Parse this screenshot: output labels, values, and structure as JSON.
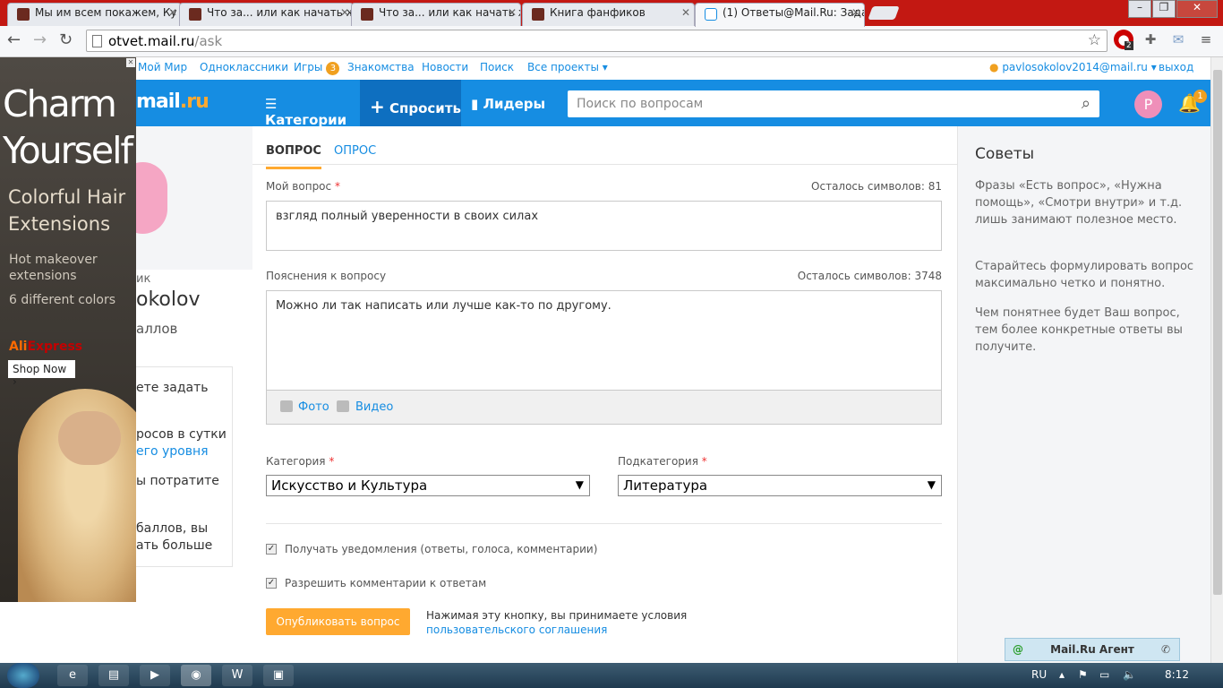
{
  "browser": {
    "tabs": [
      {
        "title": "Мы им всем покажем, Ку"
      },
      {
        "title": "Что за... или как начать ж"
      },
      {
        "title": "Что за... или как начать ж"
      },
      {
        "title": "Книга фанфиков"
      },
      {
        "title": "(1) Ответы@Mail.Ru: Зада"
      }
    ],
    "url_host": "otvet.mail.ru",
    "url_path": "/ask",
    "ext_badge": "2"
  },
  "portal": {
    "links": [
      "Мой Мир",
      "Одноклассники",
      "Игры",
      "Знакомства",
      "Новости",
      "Поиск",
      "Все проекты"
    ],
    "games_badge": "3",
    "user_email": "pavlosokolov2014@mail.ru",
    "logout": "выход"
  },
  "header": {
    "logo_main": "mail",
    "logo_suffix": ".ru",
    "nav": [
      "Категории",
      "Спросить",
      "Лидеры"
    ],
    "search_placeholder": "Поиск по вопросам",
    "avatar_letter": "P",
    "notif_count": "1"
  },
  "ad": {
    "headline1": "Charm",
    "headline2": "Yourself",
    "sub1": "Colorful Hair",
    "sub2": "Extensions",
    "small1": "Hot makeover",
    "small2": "extensions",
    "small3": "6 different colors",
    "brand1": "Ali",
    "brand2": "Express",
    "cta": "Shop Now ›"
  },
  "sidebar": {
    "role": "ик",
    "name": "okolov",
    "points": "аллов",
    "info1": "ете задать",
    "info2": "росов в сутки",
    "info3": "его уровня",
    "info4": "ы потратите",
    "info5": "баллов, вы",
    "info6": "ать больше"
  },
  "form": {
    "tab_question": "ВОПРОС",
    "tab_poll": "ОПРОС",
    "q_label": "Мой вопрос",
    "q_remaining": "Осталось символов: 81",
    "q_value": "взгляд полный уверенности в своих силах",
    "d_label": "Пояснения к вопросу",
    "d_remaining": "Осталось символов: 3748",
    "d_value": "Можно ли так написать или лучше как-то по другому.",
    "photo": "Фото",
    "video": "Видео",
    "cat_label": "Категория",
    "cat_value": "Искусство и Культура",
    "subcat_label": "Подкатегория",
    "subcat_value": "Литература",
    "notify_label": "Получать уведомления (ответы, голоса, комментарии)",
    "comments_label": "Разрешить комментарии к ответам",
    "publish": "Опубликовать вопрос",
    "terms1": "Нажимая эту кнопку, вы принимаете условия",
    "terms2": "пользовательского соглашения",
    "required_mark": "*"
  },
  "tips": {
    "title": "Советы",
    "p1": "Фразы «Есть вопрос», «Нужна помощь», «Смотри внутри» и т.д. лишь занимают полезное место.",
    "p2": "Старайтесь формулировать вопрос максимально четко и понятно.",
    "p3": "Чем понятнее будет Ваш вопрос, тем более конкретные ответы вы получите."
  },
  "agent": {
    "label": "Mail.Ru Агент"
  },
  "taskbar": {
    "lang": "RU",
    "clock": "8:12"
  },
  "colors": {
    "brand_blue": "#168de2",
    "accent_orange": "#ffa930",
    "tab_bar_red": "#c31812"
  }
}
